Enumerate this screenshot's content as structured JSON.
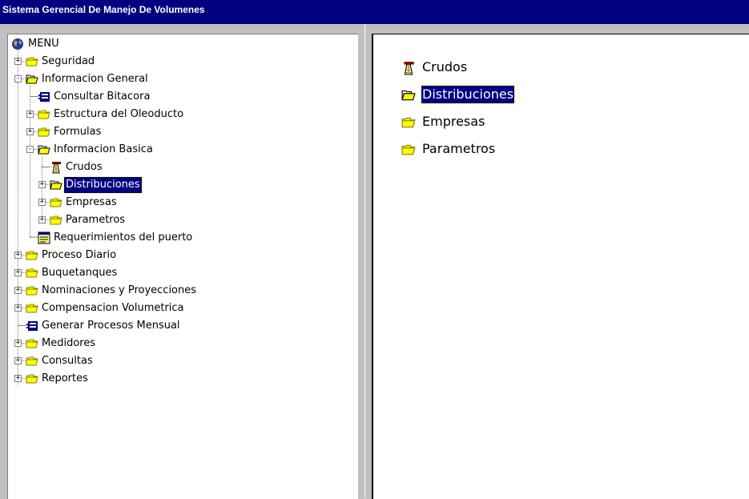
{
  "window": {
    "title": "Sistema Gerencial De Manejo De Volumenes"
  },
  "tree": {
    "root_label": "MENU",
    "items": [
      {
        "label": "Seguridad",
        "icon": "folder-icon",
        "expander": "+"
      },
      {
        "label": "Informacion General",
        "icon": "folder-open-icon",
        "expander": "-"
      },
      {
        "label": "Consultar Bitacora",
        "icon": "form-icon"
      },
      {
        "label": "Estructura del Oleoducto",
        "icon": "folder-icon",
        "expander": "+"
      },
      {
        "label": "Formulas",
        "icon": "folder-icon",
        "expander": "+"
      },
      {
        "label": "Informacion Basica",
        "icon": "folder-open-icon",
        "expander": "-"
      },
      {
        "label": "Crudos",
        "icon": "oil-derrick-icon"
      },
      {
        "label": "Distribuciones",
        "icon": "folder-open-icon",
        "expander": "+",
        "selected": true
      },
      {
        "label": "Empresas",
        "icon": "folder-icon",
        "expander": "+"
      },
      {
        "label": "Parametros",
        "icon": "folder-icon",
        "expander": "+"
      },
      {
        "label": "Requerimientos del puerto",
        "icon": "report-icon"
      },
      {
        "label": "Proceso Diario",
        "icon": "folder-icon",
        "expander": "+"
      },
      {
        "label": "Buquetanques",
        "icon": "folder-icon",
        "expander": "+"
      },
      {
        "label": "Nominaciones y Proyecciones",
        "icon": "folder-icon",
        "expander": "+"
      },
      {
        "label": "Compensacion Volumetrica",
        "icon": "folder-icon",
        "expander": "+"
      },
      {
        "label": "Generar Procesos Mensual",
        "icon": "form-icon"
      },
      {
        "label": "Medidores",
        "icon": "folder-icon",
        "expander": "+"
      },
      {
        "label": "Consultas",
        "icon": "folder-icon",
        "expander": "+"
      },
      {
        "label": "Reportes",
        "icon": "folder-icon",
        "expander": "+"
      }
    ]
  },
  "list": {
    "items": [
      {
        "label": "Crudos",
        "icon": "oil-derrick-icon"
      },
      {
        "label": "Distribuciones",
        "icon": "folder-open-icon",
        "selected": true
      },
      {
        "label": "Empresas",
        "icon": "folder-icon"
      },
      {
        "label": "Parametros",
        "icon": "folder-icon"
      }
    ]
  },
  "colors": {
    "titlebar": "#000080",
    "selection": "#000080",
    "folder": "#ffff00",
    "background": "#c0c0c0"
  }
}
